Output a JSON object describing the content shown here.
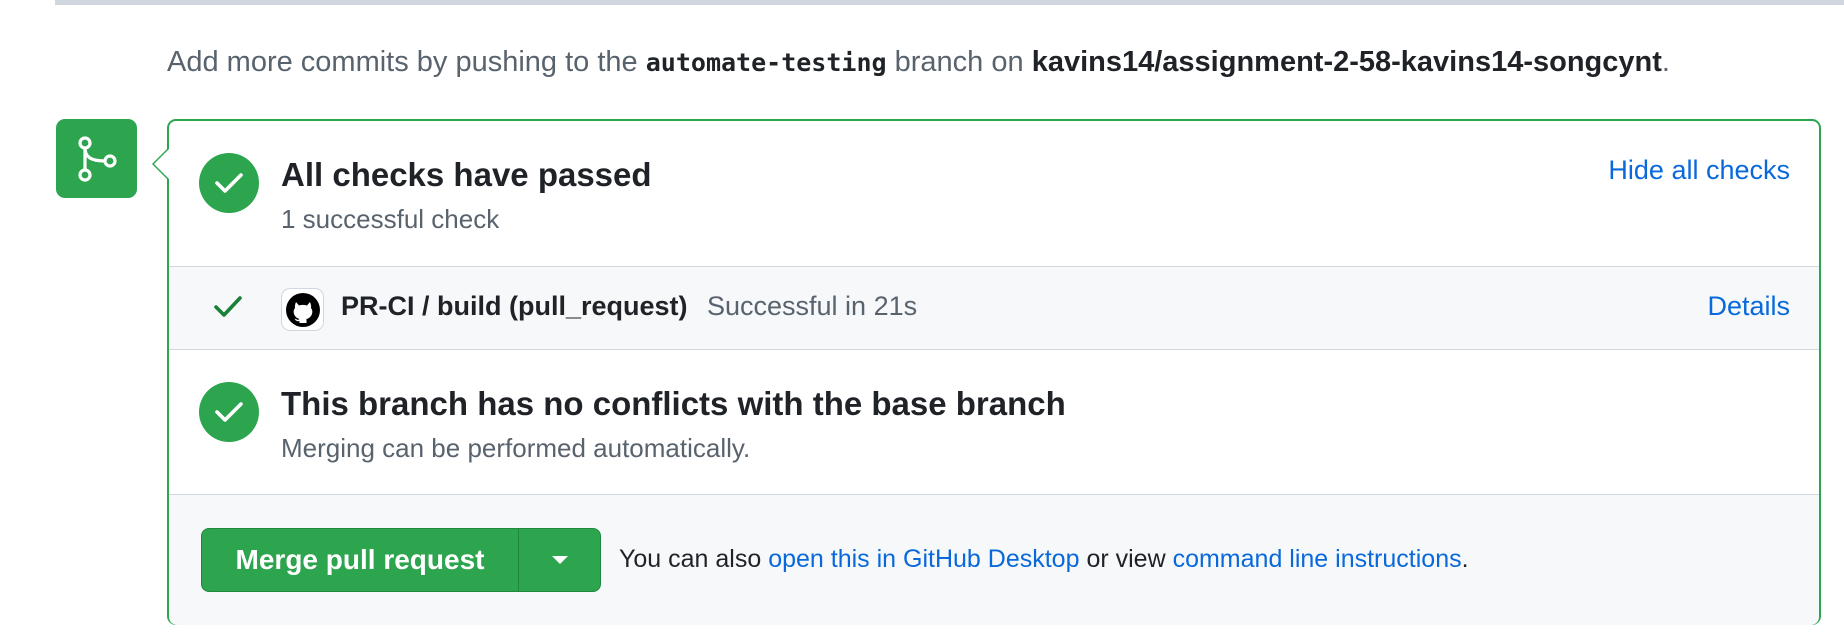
{
  "push_note": {
    "prefix": "Add more commits by pushing to the",
    "branch": "automate-testing",
    "middle": "branch on",
    "repo": "kavins14/assignment-2-58-kavins14-songcynt",
    "suffix": "."
  },
  "checks": {
    "title": "All checks have passed",
    "subtitle": "1 successful check",
    "toggle_label": "Hide all checks"
  },
  "check_run": {
    "name": "PR-CI / build (pull_request)",
    "status": "Successful in 21s",
    "details_label": "Details"
  },
  "conflicts": {
    "title": "This branch has no conflicts with the base branch",
    "subtitle": "Merging can be performed automatically."
  },
  "merge": {
    "button_label": "Merge pull request",
    "help_prefix": "You can also",
    "desktop_link": "open this in GitHub Desktop",
    "help_middle": "or view",
    "cli_link": "command line instructions",
    "help_suffix": "."
  },
  "icons": {
    "badge": "git-merge-icon",
    "check": "check-icon",
    "avatar": "github-mark-icon",
    "caret": "triangle-down-icon"
  },
  "colors": {
    "success": "#2da44e",
    "link": "#0969da",
    "muted": "#59636e",
    "border": "#d0d7de",
    "subtle_bg": "#f6f8fa"
  }
}
